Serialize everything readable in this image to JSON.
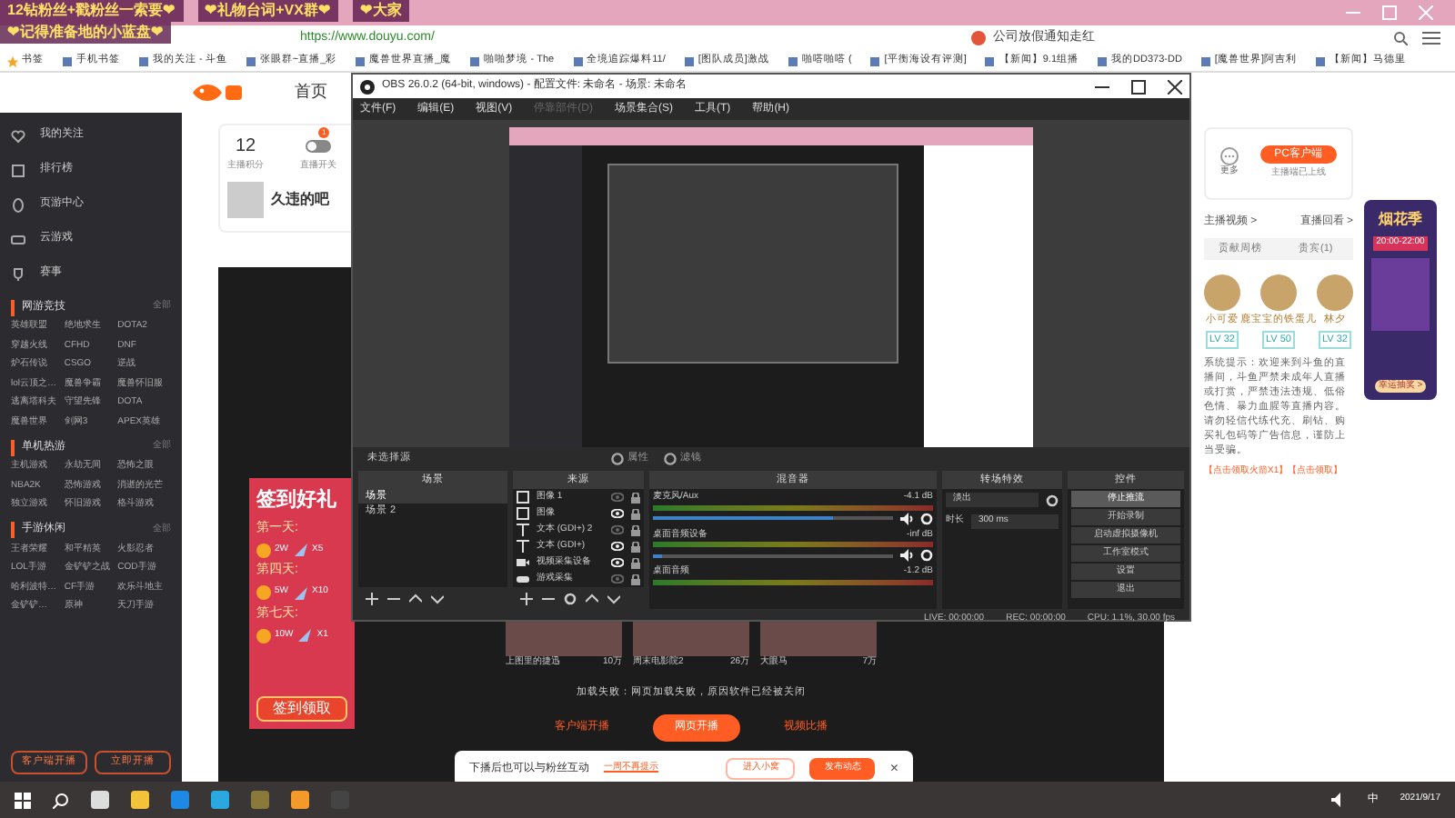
{
  "stream_banner": [
    "12钻粉丝+戳粉丝一索要❤",
    "❤礼物台词+VX群❤",
    "❤大家",
    "❤记得准备地的小蓝盘❤"
  ],
  "browser": {
    "url": "https://www.douyu.com/",
    "search": "公司放假通知走红",
    "bookmarks": [
      "书签",
      "手机书签",
      "我的关注 - 斗鱼",
      "张眼群~直播_彩",
      "魔兽世界直播_魔",
      "啪啪梦境 - The",
      "全境追踪爆料11/",
      "[图队成员]激战",
      "啪嗒啪嗒 (",
      "[平衡海设有评测]",
      "【新闻】9.1组播",
      "我的DD373-DD",
      "[魔兽世界]阿吉利",
      "【新闻】马德里"
    ]
  },
  "site": {
    "nav": [
      "首页"
    ],
    "sidebar": {
      "top_items": [
        "我的关注",
        "排行榜",
        "页游中心",
        "云游戏",
        "赛事"
      ],
      "sections": [
        {
          "title": "网游竞技",
          "more": "全部",
          "items": [
            "英雄联盟",
            "绝地求生",
            "DOTA2",
            "穿越火线",
            "CFHD",
            "DNF",
            "炉石传说",
            "CSGO",
            "逆战",
            "lol云顶之…",
            "魔兽争霸",
            "魔兽怀旧服",
            "逃离塔科夫",
            "守望先锋",
            "DOTA",
            "魔兽世界",
            "剑网3",
            "APEX英雄"
          ]
        },
        {
          "title": "单机热游",
          "more": "全部",
          "items": [
            "主机游戏",
            "永劫无间",
            "恐怖之眼",
            "NBA2K",
            "恐怖游戏",
            "消逝的光芒",
            "独立游戏",
            "怀旧游戏",
            "格斗游戏"
          ]
        },
        {
          "title": "手游休闲",
          "more": "全部",
          "items": [
            "王者荣耀",
            "和平精英",
            "火影忍者",
            "LOL手游",
            "金铲铲之战",
            "COD手游",
            "哈利波特…",
            "CF手游",
            "欢乐斗地主",
            "金铲铲…",
            "原神",
            "天刀手游"
          ]
        }
      ],
      "buttons": [
        "客户端开播",
        "立即开播"
      ]
    },
    "profile": {
      "score": "12",
      "score_label": "主播积分",
      "toggle_label": "直播开关",
      "toggle_on": false,
      "badge": "1",
      "room_title": "久违的吧",
      "more": "更多",
      "client_button": "PC客户端",
      "client_note": "主播端已上线"
    },
    "signin": {
      "title": "签到好礼",
      "days": [
        {
          "day": "第一天:",
          "coins": "2W",
          "count": "X5"
        },
        {
          "day": "第四天:",
          "coins": "5W",
          "count": "X10"
        },
        {
          "day": "第七天:",
          "coins": "10W",
          "count": "X1"
        }
      ],
      "button": "签到领取"
    },
    "videos": [
      {
        "title": "上图里的捷迅",
        "views": "10万"
      },
      {
        "title": "周末电影院2",
        "views": "26万"
      },
      {
        "title": "大眼马",
        "views": "7万"
      }
    ],
    "load_error": "加载失败：网页加载失败，原因软件已经被关闭",
    "start_buttons": [
      {
        "label": "客户端开播",
        "selected": false
      },
      {
        "label": "网页开播",
        "selected": true
      },
      {
        "label": "视频比播",
        "selected": false
      }
    ],
    "right_panel": {
      "links": [
        "主播视频 >",
        "直播回看 >"
      ],
      "tabs": [
        {
          "label": "贡献周榜",
          "selected": false
        },
        {
          "label": "贵宾(1)",
          "selected": false
        }
      ],
      "fans": [
        {
          "name": "小可爱",
          "level": "LV 32"
        },
        {
          "name": "鹿宝宝的铁蛋儿",
          "level": "LV 50"
        },
        {
          "name": "林夕",
          "level": "LV 32"
        }
      ],
      "notice": "系统提示：欢迎来到斗鱼的直播间，斗鱼严禁未成年人直播或打赏，严禁违法违规、低俗色情、暴力血腥等直播内容。请勿轻信代练代充、刷钻、购买礼包码等广告信息，谨防上当受骗。",
      "claim": "【点击领取火箭X1】【点击领取】",
      "promo": {
        "title": "烟花季",
        "time": "20:00-22:00",
        "button": "幸运抽奖 >"
      }
    },
    "toast": {
      "text": "下播后也可以与粉丝互动",
      "link": "一周不再提示",
      "buttons": [
        "进入小窝",
        "发布动态"
      ],
      "close": "×"
    }
  },
  "obs": {
    "title": "OBS 26.0.2 (64-bit, windows) - 配置文件: 未命名 - 场景: 未命名",
    "menu": [
      {
        "label": "文件(F)",
        "disabled": false
      },
      {
        "label": "编辑(E)",
        "disabled": false
      },
      {
        "label": "视图(V)",
        "disabled": false
      },
      {
        "label": "停靠部件(D)",
        "disabled": true
      },
      {
        "label": "场景集合(S)",
        "disabled": false
      },
      {
        "label": "工具(T)",
        "disabled": false
      },
      {
        "label": "帮助(H)",
        "disabled": false
      }
    ],
    "no_source": "未选择源",
    "props": [
      "属性",
      "滤镜"
    ],
    "scenes": {
      "title": "场景",
      "items": [
        {
          "label": "场景",
          "selected": true
        },
        {
          "label": "场景 2",
          "selected": false
        }
      ]
    },
    "sources": {
      "title": "来源",
      "items": [
        {
          "label": "图像 1",
          "kind": "image",
          "visible": false
        },
        {
          "label": "图像",
          "kind": "image",
          "visible": true
        },
        {
          "label": "文本 (GDI+) 2",
          "kind": "text",
          "visible": false
        },
        {
          "label": "文本 (GDI+)",
          "kind": "text",
          "visible": true
        },
        {
          "label": "视频采集设备",
          "kind": "camera",
          "visible": true
        },
        {
          "label": "游戏采集",
          "kind": "game",
          "visible": false
        }
      ]
    },
    "mixer": {
      "title": "混音器",
      "channels": [
        {
          "name": "麦克风/Aux",
          "reading": "-4.1 dB",
          "level": 0.75
        },
        {
          "name": "桌面音频设备",
          "reading": "-inf dB",
          "level": 0.04
        },
        {
          "name": "桌面音频",
          "reading": "-1.2 dB"
        }
      ]
    },
    "transitions": {
      "title": "转场特效",
      "type": "淡出",
      "duration_label": "时长",
      "duration": "300 ms"
    },
    "controls": {
      "title": "控件",
      "buttons": [
        {
          "label": "停止推流",
          "selected": true
        },
        {
          "label": "开始录制",
          "selected": false
        },
        {
          "label": "启动虚拟摄像机",
          "selected": false
        },
        {
          "label": "工作室模式",
          "selected": false
        },
        {
          "label": "设置",
          "selected": false
        },
        {
          "label": "退出",
          "selected": false
        }
      ]
    },
    "status": {
      "live": "LIVE: 00:00:00",
      "rec": "REC: 00:00:00",
      "cpu": "CPU: 1.1%, 30.00 fps"
    }
  },
  "taskbar": {
    "ime": "中",
    "date": "2021/9/17"
  }
}
